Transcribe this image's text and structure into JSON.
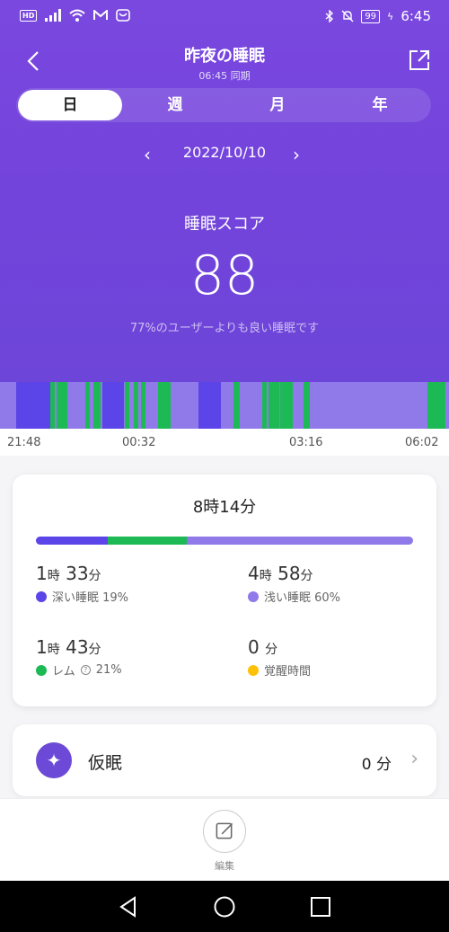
{
  "status_bar": {
    "hd": "HD",
    "battery": "99",
    "time": "6:45"
  },
  "header": {
    "title": "昨夜の睡眠",
    "sync": "06:45 同期"
  },
  "period_tabs": [
    {
      "label": "日",
      "active": true
    },
    {
      "label": "週",
      "active": false
    },
    {
      "label": "月",
      "active": false
    },
    {
      "label": "年",
      "active": false
    }
  ],
  "date": "2022/10/10",
  "score": {
    "label": "睡眠スコア",
    "value": "88",
    "comparison": "77%のユーザーよりも良い睡眠です"
  },
  "timeline": {
    "ticks": [
      "21:48",
      "00:32",
      "03:16",
      "06:02"
    ],
    "colors": {
      "deep": "#5b45e8",
      "light": "#9079e8",
      "rem": "#1db954",
      "awake": "#ffc107"
    }
  },
  "summary": {
    "total": "8時14分",
    "bar_fractions": {
      "deep": 0.19,
      "rem": 0.21,
      "light": 0.6
    },
    "deep": {
      "h": "1",
      "h_unit": "時",
      "m": "33",
      "m_unit": "分",
      "label": "深い睡眠 19%"
    },
    "light": {
      "h": "4",
      "h_unit": "時",
      "m": "58",
      "m_unit": "分",
      "label": "浅い睡眠 60%"
    },
    "rem": {
      "h": "1",
      "h_unit": "時",
      "m": "43",
      "m_unit": "分",
      "label": "レム",
      "pct": "21%"
    },
    "awake": {
      "m": "0",
      "m_unit": "分",
      "label": "覚醒時間"
    }
  },
  "nap": {
    "label": "仮眠",
    "value": "0 分"
  },
  "edit": {
    "label": "編集"
  }
}
